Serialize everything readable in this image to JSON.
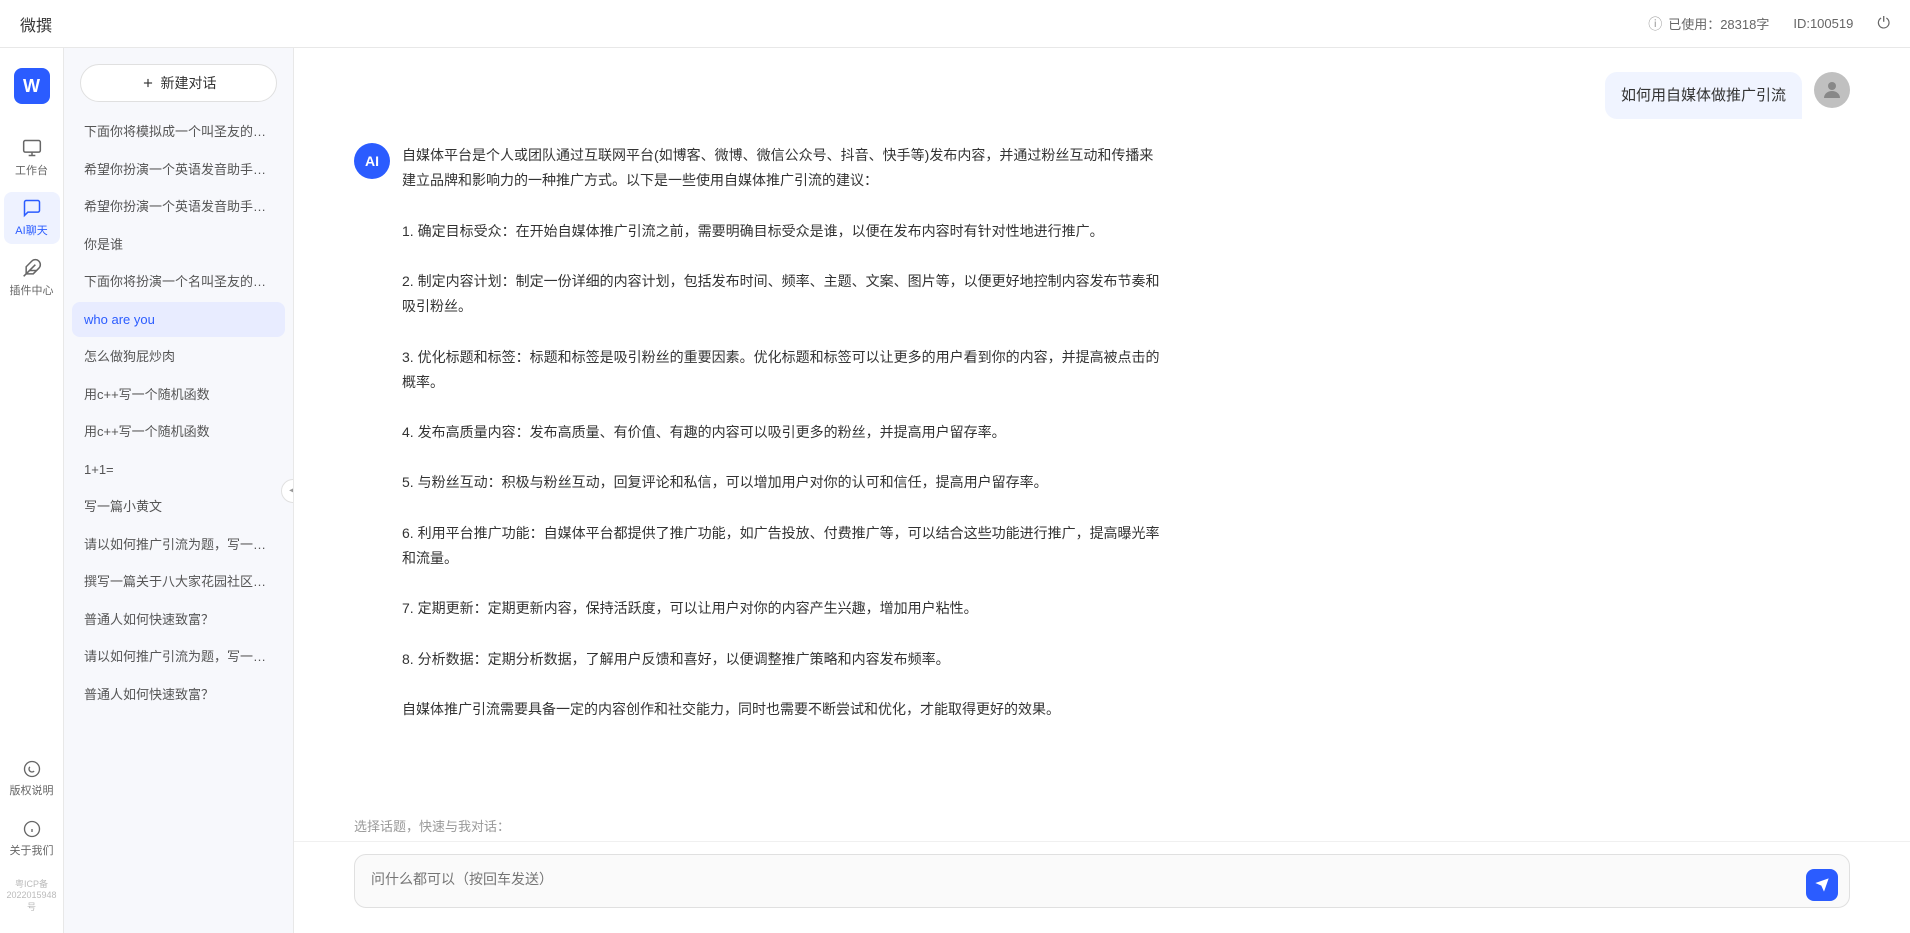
{
  "topbar": {
    "title": "微撰",
    "usage_label": "已使用：28318字",
    "usage_icon": "ⓘ",
    "id_label": "ID:100519",
    "logout_icon": "⏻"
  },
  "icon_sidebar": {
    "logo_text": "W",
    "nav_items": [
      {
        "id": "workbench",
        "label": "工作台",
        "icon": "monitor"
      },
      {
        "id": "ai-chat",
        "label": "AI聊天",
        "icon": "chat",
        "active": true
      },
      {
        "id": "plugin",
        "label": "插件中心",
        "icon": "plugin"
      }
    ],
    "bottom_items": [
      {
        "id": "copyright",
        "label": "版权说明",
        "icon": "copyright"
      },
      {
        "id": "about",
        "label": "关于我们",
        "icon": "info"
      }
    ],
    "icp": "粤ICP备2022015948号"
  },
  "history_sidebar": {
    "new_chat_label": "新建对话",
    "items": [
      {
        "id": "h1",
        "text": "下面你将模拟成一个叫圣友的程序员，我说...",
        "active": false
      },
      {
        "id": "h2",
        "text": "希望你扮演一个英语发音助手，我提供给你...",
        "active": false
      },
      {
        "id": "h3",
        "text": "希望你扮演一个英语发音助手，我提供给你...",
        "active": false
      },
      {
        "id": "h4",
        "text": "你是谁",
        "active": false
      },
      {
        "id": "h5",
        "text": "下面你将扮演一个名叫圣友的医生",
        "active": false
      },
      {
        "id": "h6",
        "text": "who are you",
        "active": true
      },
      {
        "id": "h7",
        "text": "怎么做狗屁炒肉",
        "active": false
      },
      {
        "id": "h8",
        "text": "用c++写一个随机函数",
        "active": false
      },
      {
        "id": "h9",
        "text": "用c++写一个随机函数",
        "active": false
      },
      {
        "id": "h10",
        "text": "1+1=",
        "active": false
      },
      {
        "id": "h11",
        "text": "写一篇小黄文",
        "active": false
      },
      {
        "id": "h12",
        "text": "请以如何推广引流为题，写一篇大纲",
        "active": false
      },
      {
        "id": "h13",
        "text": "撰写一篇关于八大家花园社区一刻钟便民生...",
        "active": false
      },
      {
        "id": "h14",
        "text": "普通人如何快速致富？",
        "active": false
      },
      {
        "id": "h15",
        "text": "请以如何推广引流为题，写一篇大纲",
        "active": false
      },
      {
        "id": "h16",
        "text": "普通人如何快速致富？",
        "active": false
      }
    ]
  },
  "chat": {
    "messages": [
      {
        "id": "m1",
        "role": "user",
        "text": "如何用自媒体做推广引流",
        "avatar_type": "user"
      },
      {
        "id": "m2",
        "role": "ai",
        "text": "自媒体平台是个人或团队通过互联网平台(如博客、微博、微信公众号、抖音、快手等)发布内容，并通过粉丝互动和传播来建立品牌和影响力的一种推广方式。以下是一些使用自媒体推广引流的建议：\n\n1. 确定目标受众：在开始自媒体推广引流之前，需要明确目标受众是谁，以便在发布内容时有针对性地进行推广。\n\n2. 制定内容计划：制定一份详细的内容计划，包括发布时间、频率、主题、文案、图片等，以便更好地控制内容发布节奏和吸引粉丝。\n\n3. 优化标题和标签：标题和标签是吸引粉丝的重要因素。优化标题和标签可以让更多的用户看到你的内容，并提高被点击的概率。\n\n4. 发布高质量内容：发布高质量、有价值、有趣的内容可以吸引更多的粉丝，并提高用户留存率。\n\n5. 与粉丝互动：积极与粉丝互动，回复评论和私信，可以增加用户对你的认可和信任，提高用户留存率。\n\n6. 利用平台推广功能：自媒体平台都提供了推广功能，如广告投放、付费推广等，可以结合这些功能进行推广，提高曝光率和流量。\n\n7. 定期更新：定期更新内容，保持活跃度，可以让用户对你的内容产生兴趣，增加用户粘性。\n\n8. 分析数据：定期分析数据，了解用户反馈和喜好，以便调整推广策略和内容发布频率。\n\n自媒体推广引流需要具备一定的内容创作和社交能力，同时也需要不断尝试和优化，才能取得更好的效果。",
        "avatar_type": "ai"
      }
    ],
    "quick_topics_label": "选择话题，快速与我对话：",
    "input_placeholder": "问什么都可以（按回车发送）"
  }
}
